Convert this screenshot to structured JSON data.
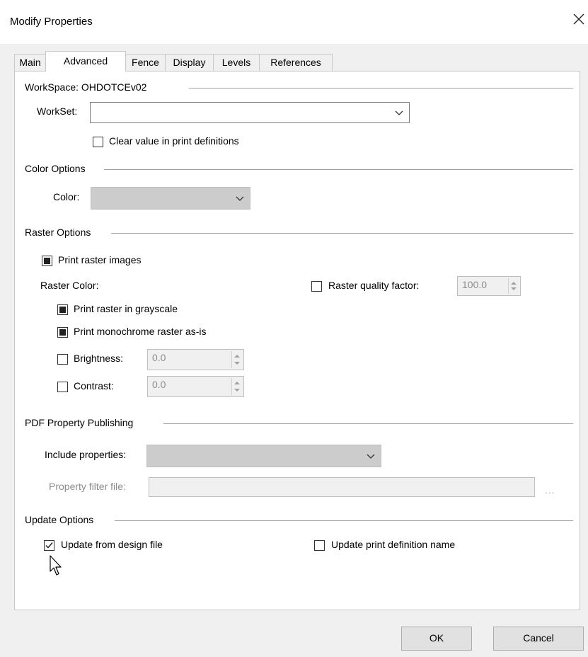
{
  "window": {
    "title": "Modify Properties"
  },
  "tabs": [
    {
      "label": "Main"
    },
    {
      "label": "Advanced"
    },
    {
      "label": "Fence"
    },
    {
      "label": "Display"
    },
    {
      "label": "Levels"
    },
    {
      "label": "References"
    }
  ],
  "active_tab": "Advanced",
  "workspace": {
    "group_label": "WorkSpace: OHDOTCEv02",
    "workset_label": "WorkSet:",
    "workset_value": "",
    "clear_label": "Clear value in print definitions",
    "clear_checked": false
  },
  "color_options": {
    "group_label": "Color Options",
    "color_label": "Color:",
    "color_value": ""
  },
  "raster_options": {
    "group_label": "Raster Options",
    "print_raster_label": "Print raster images",
    "print_raster_state": "indeterminate",
    "raster_color_label": "Raster Color:",
    "quality_label": "Raster quality factor:",
    "quality_checked": false,
    "quality_value": "100.0",
    "grayscale_label": "Print raster in grayscale",
    "grayscale_state": "indeterminate",
    "monochrome_label": "Print monochrome raster as-is",
    "monochrome_state": "indeterminate",
    "brightness_label": "Brightness:",
    "brightness_checked": false,
    "brightness_value": "0.0",
    "contrast_label": "Contrast:",
    "contrast_checked": false,
    "contrast_value": "0.0"
  },
  "pdf": {
    "group_label": "PDF Property Publishing",
    "include_label": "Include properties:",
    "include_value": "",
    "filter_label": "Property filter file:",
    "filter_value": "",
    "browse_label": "..."
  },
  "update": {
    "group_label": "Update Options",
    "from_design_label": "Update from design file",
    "from_design_checked": true,
    "print_def_label": "Update print definition name",
    "print_def_checked": false
  },
  "buttons": {
    "ok": "OK",
    "cancel": "Cancel"
  },
  "icons": {
    "close": "close-icon",
    "dropdown": "chevron-down-icon",
    "cursor": "mouse-pointer-icon"
  },
  "colors": {
    "panel": "#ffffff",
    "dialog": "#f0f0f0",
    "disabled": "#cccccc"
  }
}
